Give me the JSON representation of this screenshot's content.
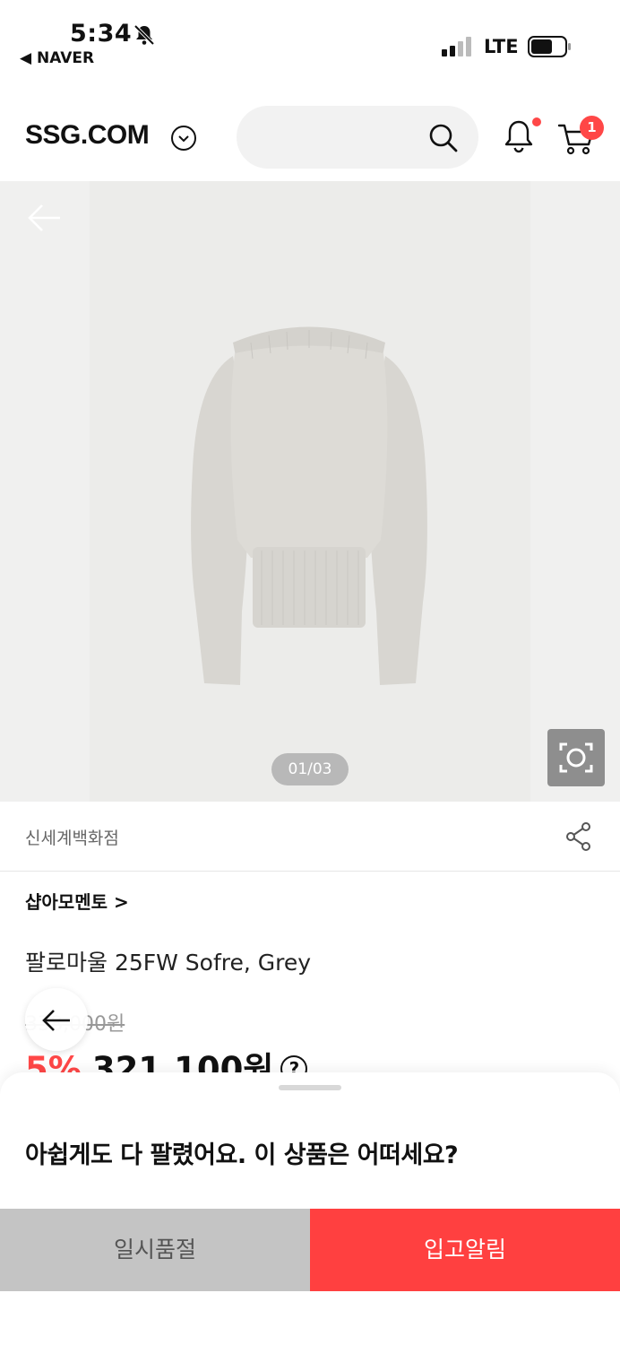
{
  "status_bar": {
    "time": "5:34",
    "back_app": "◀ NAVER",
    "network": "LTE"
  },
  "header": {
    "logo": "SSG.COM",
    "search_placeholder": "",
    "cart_count": "1",
    "icons": [
      "chevron-down-icon",
      "search-icon",
      "bell-icon",
      "cart-icon"
    ]
  },
  "gallery": {
    "counter": "01/03"
  },
  "seller": {
    "name": "신세계백화점"
  },
  "product": {
    "brand": "샵아모멘토 >",
    "title": "팔로마울 25FW Sofre, Grey",
    "original_price": "338,000원",
    "discount": "5%",
    "sale_price": "321,100원"
  },
  "sheet": {
    "message": "아쉽게도 다 팔렸어요. 이 상품은 어떠세요?",
    "soldout_label": "일시품절",
    "restock_label": "입고알림"
  },
  "colors": {
    "accent": "#ff4747",
    "restock_button": "#ff4040",
    "soldout_button": "#c4c4c4"
  }
}
